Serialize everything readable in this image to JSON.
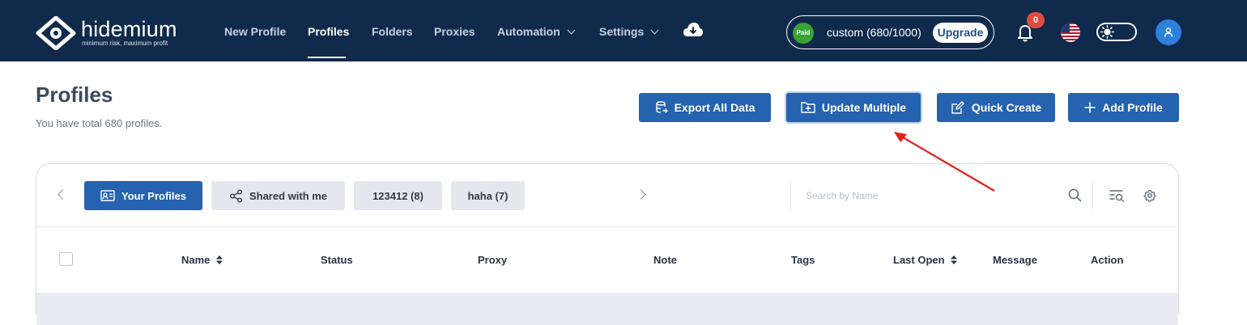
{
  "app": {
    "logo_name": "hidemium",
    "logo_tagline": "minimum risk, maximum profit"
  },
  "nav": {
    "items": [
      {
        "label": "New Profile",
        "active": false,
        "dropdown": false
      },
      {
        "label": "Profiles",
        "active": true,
        "dropdown": false
      },
      {
        "label": "Folders",
        "active": false,
        "dropdown": false
      },
      {
        "label": "Proxies",
        "active": false,
        "dropdown": false
      },
      {
        "label": "Automation",
        "active": false,
        "dropdown": true
      },
      {
        "label": "Settings",
        "active": false,
        "dropdown": true
      }
    ],
    "download_icon": "cloud-download-icon"
  },
  "plan": {
    "badge": "Paid",
    "label": "custom (680/1000)",
    "upgrade_label": "Upgrade"
  },
  "notifications": {
    "count": "0"
  },
  "language_flag": "us-flag-icon",
  "header": {
    "title": "Profiles",
    "subtitle": "You have total 680 profiles."
  },
  "actions": {
    "export_label": "Export All Data",
    "update_multiple_label": "Update Multiple",
    "quick_create_label": "Quick Create",
    "add_profile_label": "Add Profile"
  },
  "tabs": [
    {
      "label": "Your Profiles",
      "active": true
    },
    {
      "label": "Shared with me",
      "active": false
    },
    {
      "label": "123412 (8)",
      "active": false
    },
    {
      "label": "haha (7)",
      "active": false
    }
  ],
  "search": {
    "placeholder": "Search by Name",
    "value": ""
  },
  "table": {
    "columns": [
      "Name",
      "Status",
      "Proxy",
      "Note",
      "Tags",
      "Last Open",
      "Message",
      "Action"
    ],
    "sortable": [
      "Name",
      "Last Open"
    ]
  },
  "colors": {
    "topbar": "#0f2a4a",
    "primary": "#2563b0",
    "paid_green": "#3aa338",
    "badge_red": "#e04a3f",
    "annotation_arrow": "#e5211c"
  }
}
